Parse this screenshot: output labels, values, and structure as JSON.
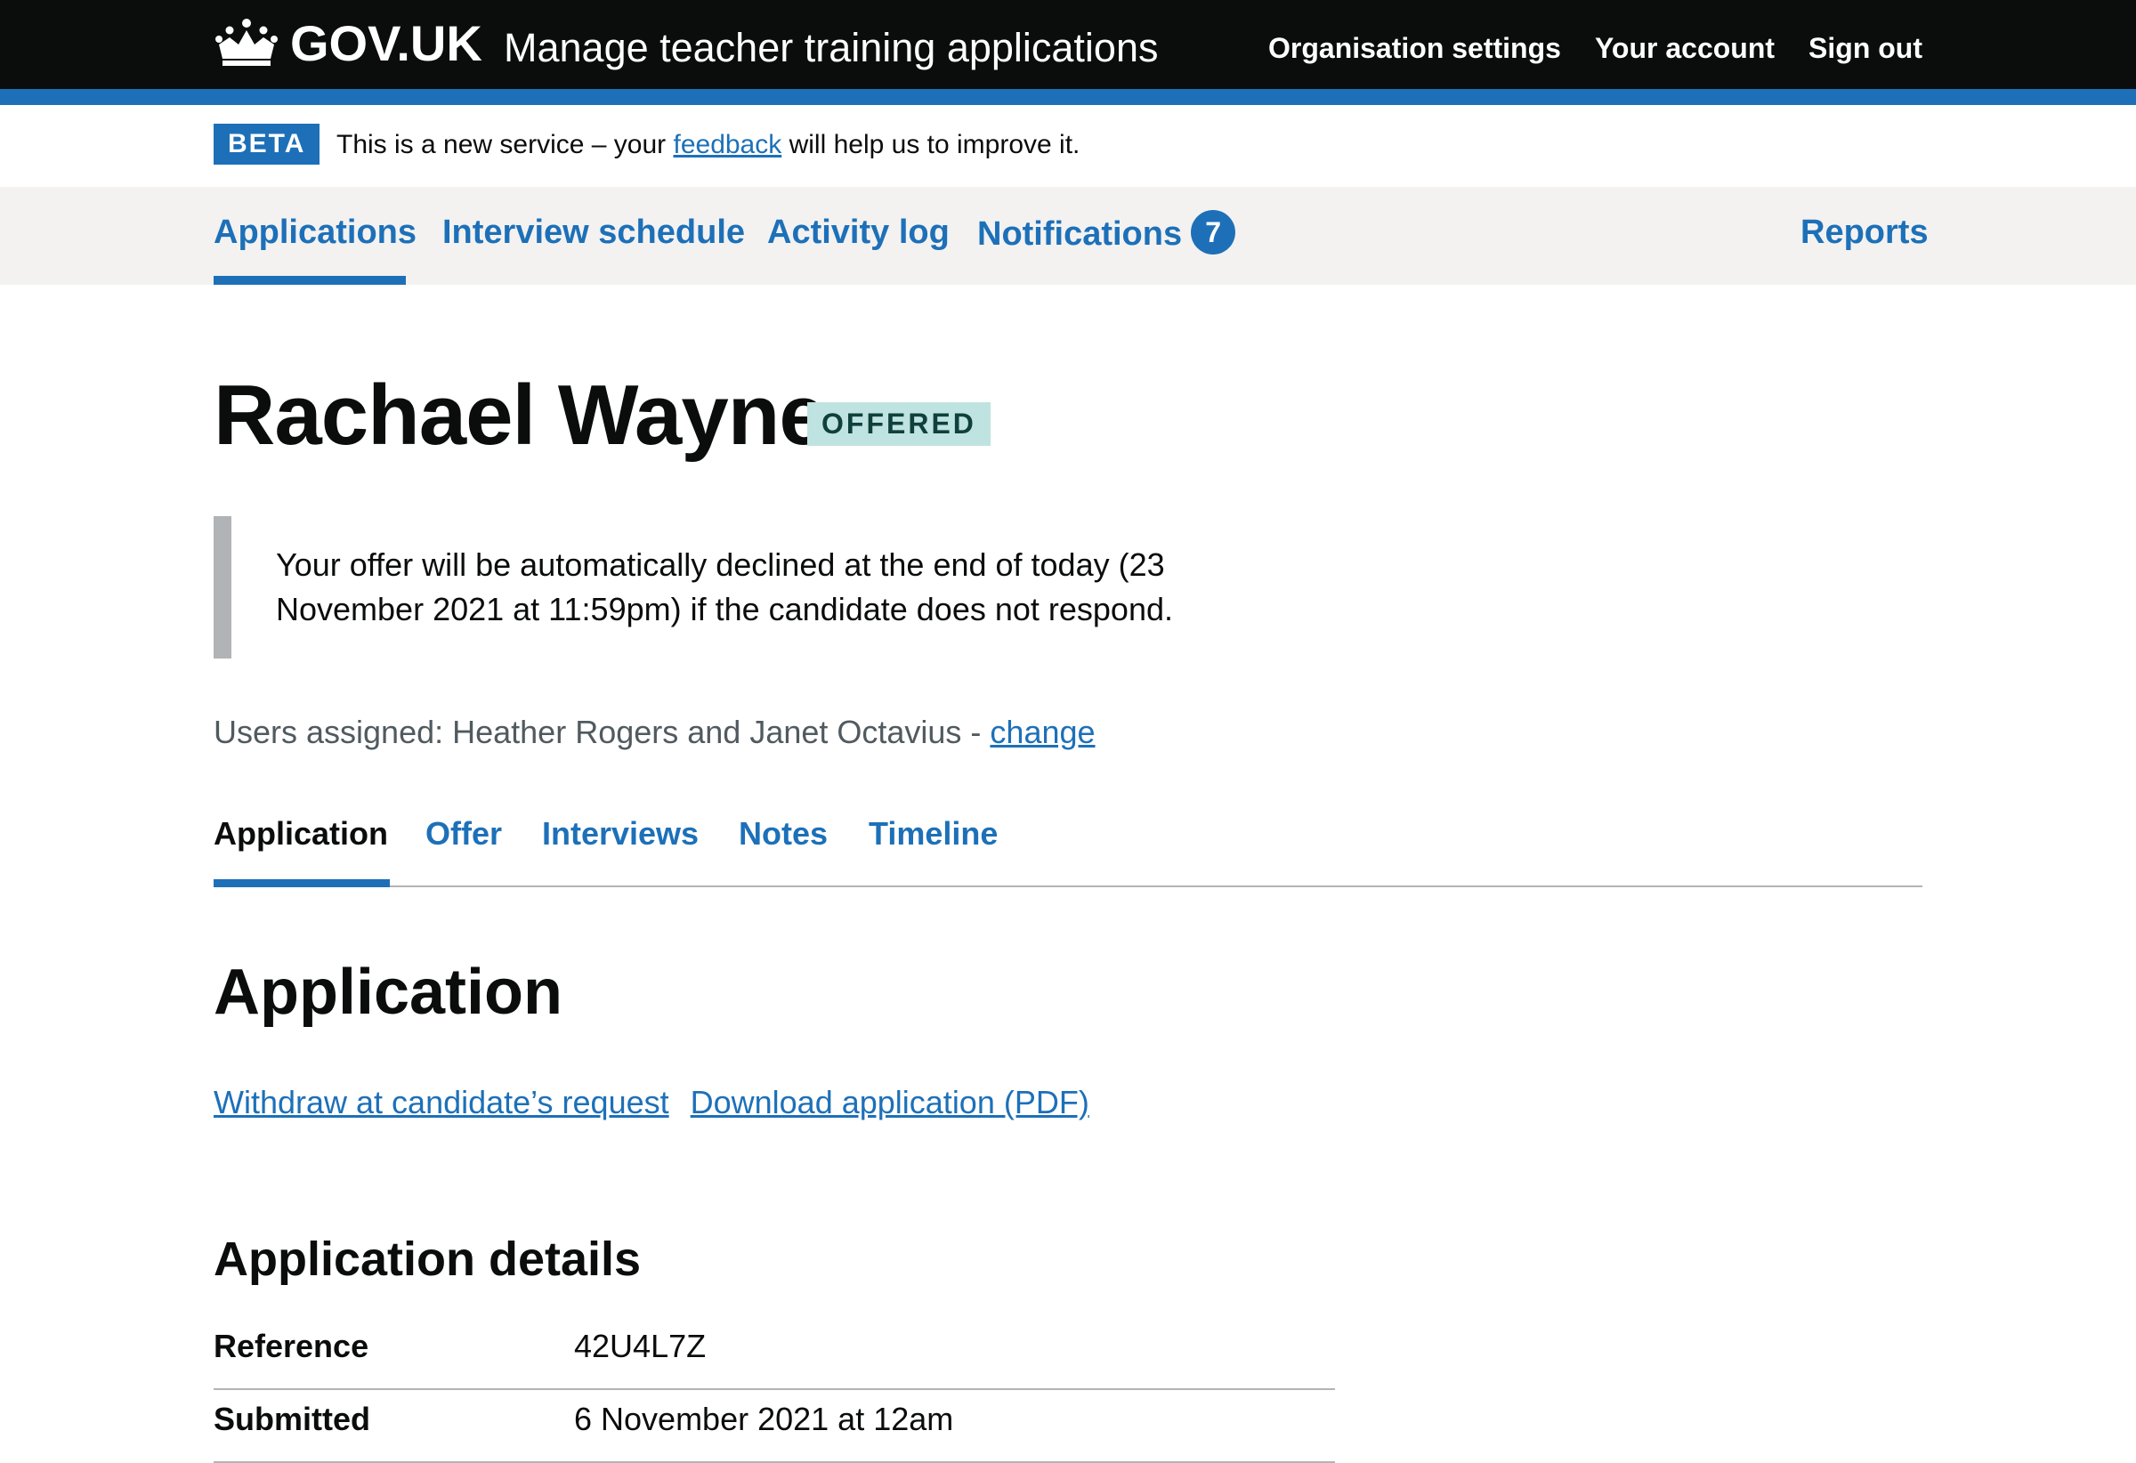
{
  "header": {
    "logo_text": "GOV.UK",
    "service_name": "Manage teacher training applications",
    "nav": [
      "Organisation settings",
      "Your account",
      "Sign out"
    ]
  },
  "phase_banner": {
    "tag": "BETA",
    "text_before": "This is a new service – your ",
    "link": "feedback",
    "text_after": " will help us to improve it."
  },
  "primary_nav": {
    "items": [
      "Applications",
      "Interview schedule",
      "Activity log",
      "Notifications",
      "Reports"
    ],
    "active": "Applications",
    "notifications_count": "7"
  },
  "candidate": {
    "name": "Rachael Wayne",
    "status": "OFFERED"
  },
  "inset": {
    "text": "Your offer will be automatically declined at the end of today (23 November 2021 at 11:59pm) if the candidate does not respond."
  },
  "assigned": {
    "label": "Users assigned: Heather Rogers and Janet Octavius - ",
    "link": "change"
  },
  "sub_tabs": {
    "items": [
      "Application",
      "Offer",
      "Interviews",
      "Notes",
      "Timeline"
    ],
    "active": "Application"
  },
  "main": {
    "title": "Application",
    "actions": [
      "Withdraw at candidate’s request",
      "Download application (PDF)"
    ],
    "details_title": "Application details",
    "summary": [
      {
        "key": "Reference",
        "value": "42U4L7Z"
      },
      {
        "key": "Submitted",
        "value": "6 November 2021 at 12am"
      }
    ]
  },
  "colors": {
    "header_bg": "#0b0c0c",
    "brand_blue": "#1d70b8",
    "nav_bg": "#f3f2f1",
    "status_tag_bg": "#bfe3e0",
    "status_tag_text": "#10403c",
    "inset_border": "#b1b4b6"
  }
}
